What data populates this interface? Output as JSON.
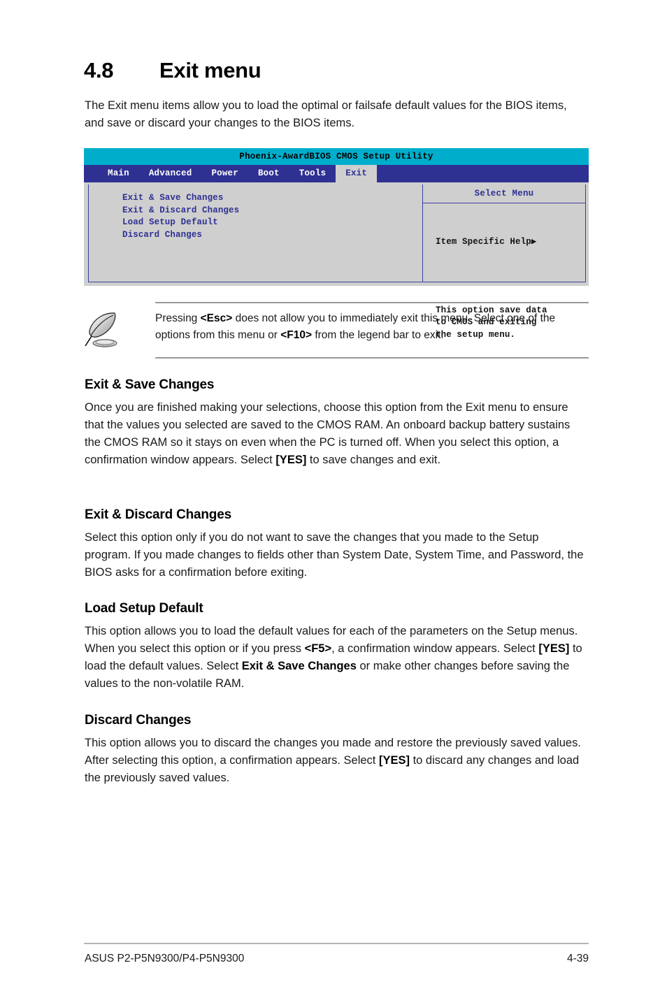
{
  "heading": {
    "number": "4.8",
    "title": "Exit menu"
  },
  "intro": "The Exit menu items allow you to load the optimal or failsafe default values for the BIOS items, and save or discard your changes to the BIOS items.",
  "bios": {
    "title": "Phoenix-AwardBIOS CMOS Setup Utility",
    "tabs": [
      {
        "label": "Main",
        "active": false
      },
      {
        "label": "Advanced",
        "active": false
      },
      {
        "label": "Power",
        "active": false
      },
      {
        "label": "Boot",
        "active": false
      },
      {
        "label": "Tools",
        "active": false
      },
      {
        "label": "Exit",
        "active": true
      }
    ],
    "items": [
      "Exit & Save Changes",
      "Exit & Discard Changes",
      "Load Setup Default",
      "Discard Changes"
    ],
    "help_panel": {
      "header": "Select Menu",
      "subtitle": "Item Specific Help▶",
      "text": "This option save data\nto CMOS and exiting\nthe setup menu."
    },
    "colors": {
      "title_bar": "#00aecb",
      "menu_bar": "#2e3192",
      "panel_bg": "#cfcfcf",
      "item_text": "#2e3192",
      "active_tab_bg": "#cfcfcf"
    }
  },
  "note": {
    "icon": "quill-pen-icon",
    "text_parts": [
      {
        "text": "Pressing ",
        "bold": false
      },
      {
        "text": "<Esc>",
        "bold": true
      },
      {
        "text": " does not allow you to immediately exit this menu. Select one of the options from this menu or ",
        "bold": false
      },
      {
        "text": "<F10>",
        "bold": true
      },
      {
        "text": " from the legend bar to exit.",
        "bold": false
      }
    ]
  },
  "sections": [
    {
      "id": "sec-save",
      "heading": "Exit & Save Changes",
      "body_parts": [
        {
          "text": "Once you are finished making your selections, choose this option from the Exit menu to ensure that the values you selected are saved to the CMOS RAM. An onboard backup battery sustains the CMOS RAM so it stays on even when the PC is turned off. When you select this option, a confirmation window appears. Select ",
          "bold": false
        },
        {
          "text": "[YES]",
          "bold": true
        },
        {
          "text": " to save changes and exit.",
          "bold": false
        }
      ]
    },
    {
      "id": "sec-discard",
      "heading": "Exit & Discard Changes",
      "body_parts": [
        {
          "text": "Select this option only if you do not want to save the changes that you made to the Setup program. If you made changes to fields other than System Date, System Time, and Password, the BIOS asks for a confirmation before exiting.",
          "bold": false
        }
      ]
    },
    {
      "id": "sec-load",
      "heading": "Load Setup Default",
      "body_parts": [
        {
          "text": "This option allows you to load the default values for each of the parameters on the Setup menus. When you select this option or if you press ",
          "bold": false
        },
        {
          "text": "<F5>",
          "bold": true
        },
        {
          "text": ", a confirmation window appears. Select ",
          "bold": false
        },
        {
          "text": "[YES]",
          "bold": true
        },
        {
          "text": " to load the default values. Select ",
          "bold": false
        },
        {
          "text": "Exit & Save Changes",
          "bold": true
        },
        {
          "text": " or make other changes before saving the values to the non-volatile RAM.",
          "bold": false
        }
      ]
    },
    {
      "id": "sec-disc2",
      "heading": "Discard Changes",
      "body_parts": [
        {
          "text": "This option allows you to discard the changes you made and restore the previously saved values. After selecting this option, a confirmation appears. Select ",
          "bold": false
        },
        {
          "text": "[YES]",
          "bold": true
        },
        {
          "text": " to discard any changes and load the previously saved values.",
          "bold": false
        }
      ]
    }
  ],
  "footer": {
    "left": "ASUS P2-P5N9300/P4-P5N9300",
    "right": "4-39"
  }
}
